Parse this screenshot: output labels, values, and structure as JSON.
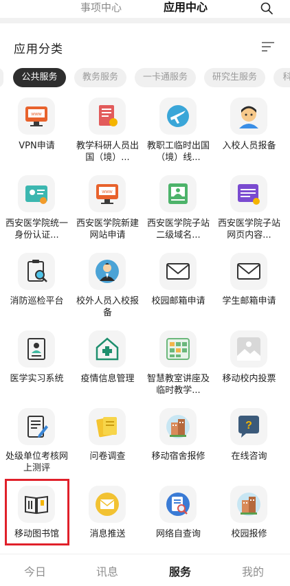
{
  "top_tabs": [
    "事项中心",
    "应用中心"
  ],
  "section_title": "应用分类",
  "categories": [
    "公共服务",
    "教务服务",
    "一卡通服务",
    "研究生服务",
    "科"
  ],
  "apps": [
    {
      "label": "VPN申请",
      "icon": "monitor-www-icon"
    },
    {
      "label": "教学科研人员出国（境）...",
      "icon": "document-badge-icon"
    },
    {
      "label": "教职工临时出国（境）线...",
      "icon": "airplane-icon"
    },
    {
      "label": "入校人员报备",
      "icon": "person-face-icon"
    },
    {
      "label": "西安医学院统一身份认证...",
      "icon": "id-card-icon"
    },
    {
      "label": "西安医学院新建网站申请",
      "icon": "monitor-www-icon"
    },
    {
      "label": "西安医学院子站二级域名...",
      "icon": "document-person-icon"
    },
    {
      "label": "西安医学院子站网页内容...",
      "icon": "browser-window-icon"
    },
    {
      "label": "消防巡检平台",
      "icon": "clipboard-magnifier-icon"
    },
    {
      "label": "校外人员入校报备",
      "icon": "person-suit-icon"
    },
    {
      "label": "校园邮箱申请",
      "icon": "envelope-icon"
    },
    {
      "label": "学生邮箱申请",
      "icon": "envelope-icon"
    },
    {
      "label": "医学实习系统",
      "icon": "person-card-icon"
    },
    {
      "label": "疫情信息管理",
      "icon": "medical-house-icon"
    },
    {
      "label": "智慧教室讲座及临时教学...",
      "icon": "calendar-grid-icon"
    },
    {
      "label": "移动校内投票",
      "icon": "image-placeholder-icon"
    },
    {
      "label": "处级单位考核网上测评",
      "icon": "document-pencil-icon"
    },
    {
      "label": "问卷调查",
      "icon": "notes-icon"
    },
    {
      "label": "移动宿舍报修",
      "icon": "buildings-icon"
    },
    {
      "label": "在线咨询",
      "icon": "chat-question-icon"
    },
    {
      "label": "移动图书馆",
      "icon": "open-book-icon"
    },
    {
      "label": "消息推送",
      "icon": "envelope-circle-icon"
    },
    {
      "label": "网络自查询",
      "icon": "search-document-icon"
    },
    {
      "label": "校园报修",
      "icon": "buildings-icon"
    }
  ],
  "bottom_tabs": [
    "今日",
    "讯息",
    "服务",
    "我的"
  ],
  "colors": {
    "active_chip": "#2e2e2e",
    "highlight_border": "#e0202a"
  }
}
